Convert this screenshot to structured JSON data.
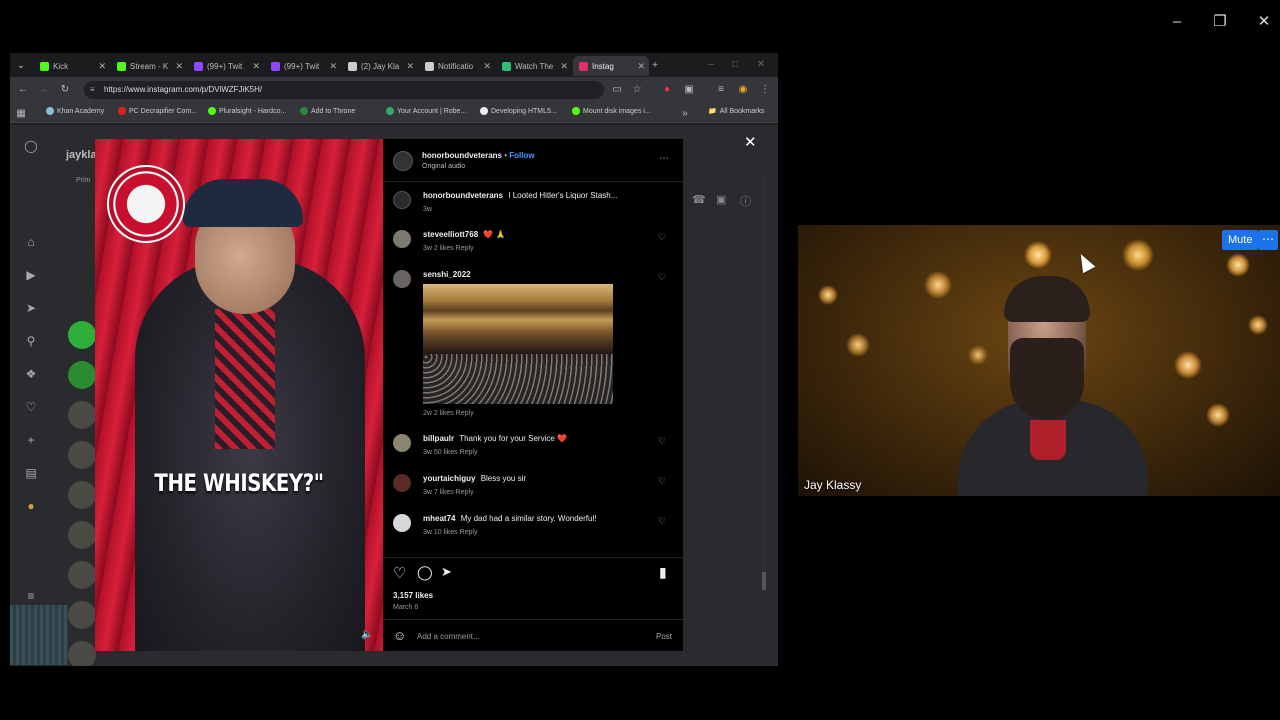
{
  "browser": {
    "tabs": [
      {
        "label": "Kick",
        "color": "#53fc18"
      },
      {
        "label": "Stream - K",
        "color": "#53fc18"
      },
      {
        "label": "(99+) Twit",
        "color": "#9146ff"
      },
      {
        "label": "(99+) Twit",
        "color": "#9146ff"
      },
      {
        "label": "(2) Jay Kla",
        "color": "#cccccc"
      },
      {
        "label": "Notificatio",
        "color": "#cccccc"
      },
      {
        "label": "Watch The",
        "color": "#2bbf74"
      },
      {
        "label": "Instag",
        "color": "#e1306c"
      }
    ],
    "url": "https://www.instagram.com/p/DViWZFJiK5H/",
    "bookmarks": [
      "Khan Academy",
      "PC Decrapifier Com...",
      "Pluralsight - Hardco...",
      "Add to Throne",
      "Your Account | Robe...",
      "Developing HTML5...",
      "Mount disk images i..."
    ],
    "all_bookmarks": "All Bookmarks"
  },
  "ig_behind": {
    "username": "jayklass",
    "primary_tab": "Prim"
  },
  "post": {
    "author": "honorboundveterans",
    "follow_label": "Follow",
    "audio": "Original audio",
    "caption_user": "honorboundveterans",
    "caption_text": "I Looted Hitler's Liquor Stash...",
    "caption_age": "3w",
    "video_caption": "THE WHISKEY?\"",
    "likes": "3,157 likes",
    "date": "March 6",
    "add_comment_placeholder": "Add a comment...",
    "post_label": "Post",
    "comments": [
      {
        "user": "steveelliott768",
        "text": "❤️ 🙏",
        "meta": "3w   2 likes   Reply"
      },
      {
        "user": "senshi_2022",
        "text": "",
        "meta": "2w   2 likes   Reply"
      },
      {
        "user": "billpaulr",
        "text": "Thank you for your Service ❤️",
        "meta": "3w   50 likes   Reply"
      },
      {
        "user": "yourtaichiguy",
        "text": "Bless you sir",
        "meta": "3w   7 likes   Reply"
      },
      {
        "user": "mheat74",
        "text": "My dad had a similar story. Wonderful!",
        "meta": "3w   10 likes   Reply"
      }
    ]
  },
  "webcam": {
    "name": "Jay Klassy",
    "mute_label": "Mute",
    "more_label": "⋯"
  }
}
